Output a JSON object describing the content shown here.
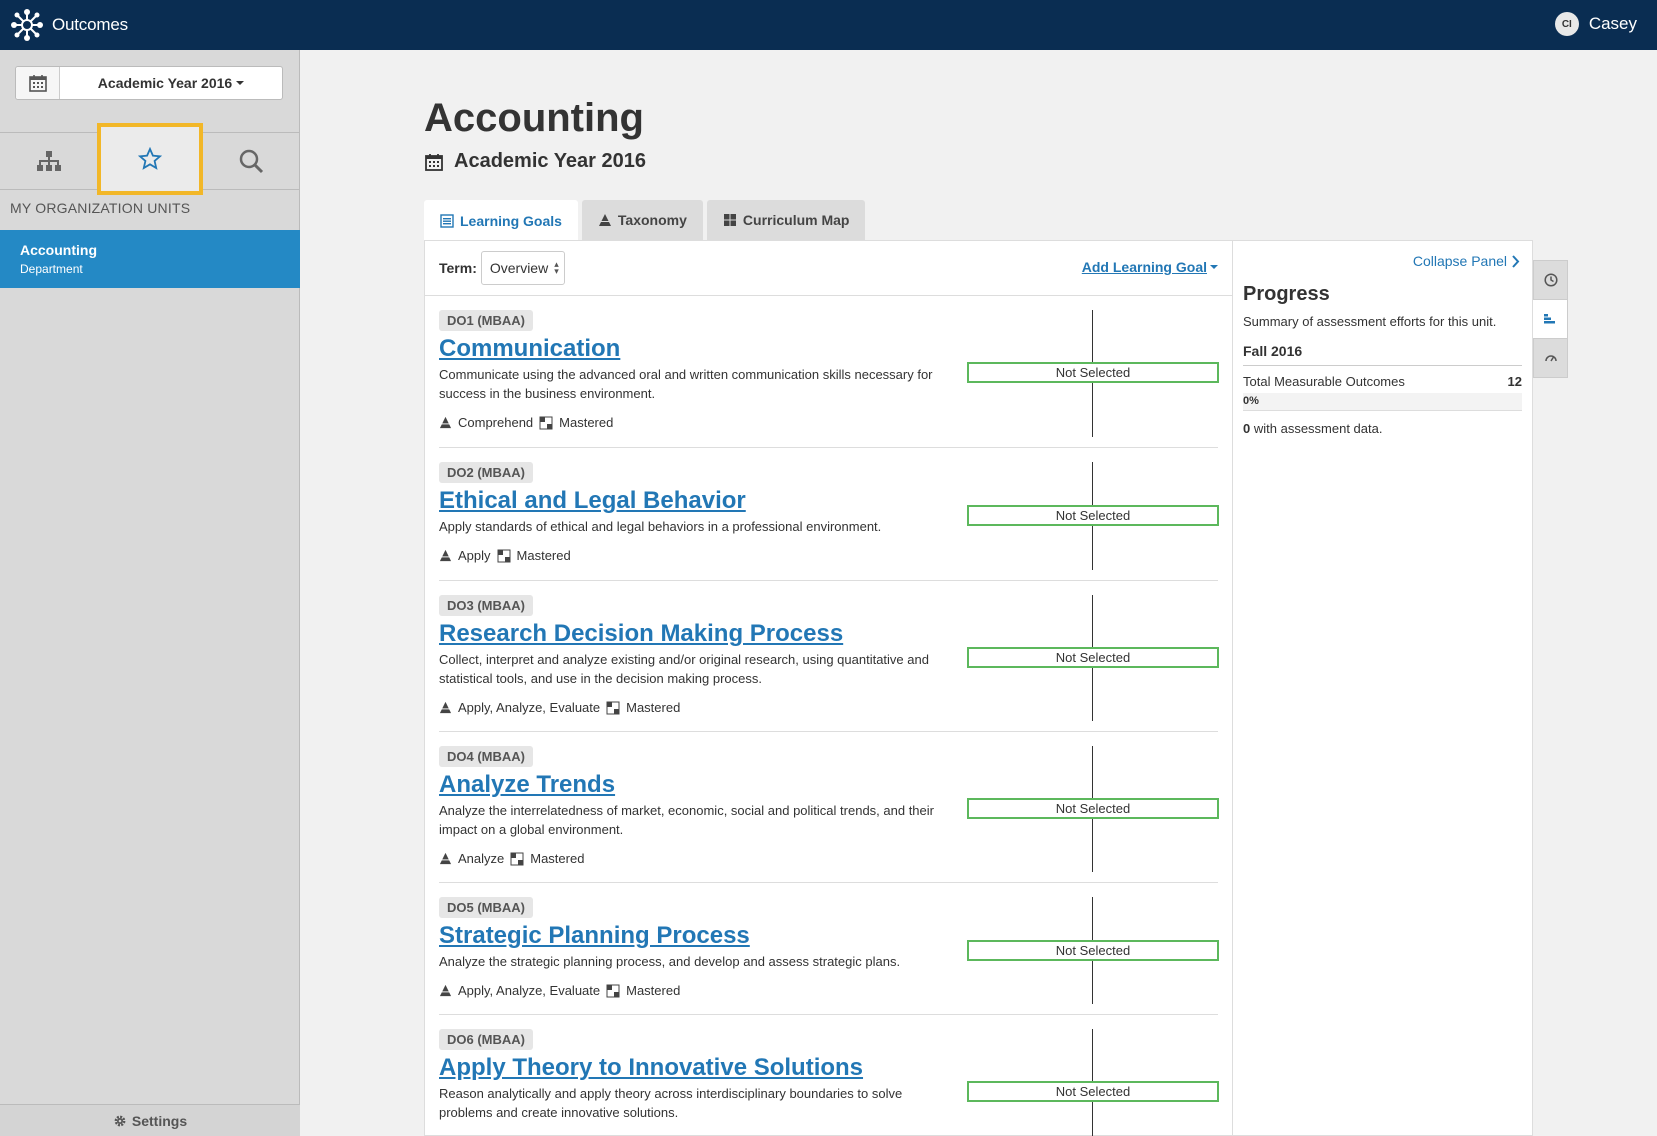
{
  "app": {
    "name": "Outcomes",
    "user_initials": "CI",
    "user_name": "Casey"
  },
  "sidebar": {
    "year_label": "Academic Year 2016",
    "section_label": "MY ORGANIZATION UNITS",
    "tabs": [
      {
        "icon": "hierarchy-icon",
        "active": false
      },
      {
        "icon": "star-icon",
        "active": true
      },
      {
        "icon": "search-icon",
        "active": false
      }
    ],
    "unit": {
      "name": "Accounting",
      "type": "Department"
    },
    "settings_label": "Settings"
  },
  "main": {
    "title": "Accounting",
    "subtitle": "Academic Year 2016",
    "tabs": [
      {
        "label": "Learning Goals",
        "icon": "list-icon",
        "active": true
      },
      {
        "label": "Taxonomy",
        "icon": "pyramid-icon",
        "active": false
      },
      {
        "label": "Curriculum Map",
        "icon": "grid-icon",
        "active": false
      }
    ],
    "term_label": "Term:",
    "term_value": "Overview",
    "add_goal_label": "Add Learning Goal",
    "goals": [
      {
        "code": "DO1 (MBAA)",
        "title": "Communication",
        "description": "Communicate using the advanced oral and written communication skills necessary for success in the business environment.",
        "taxonomy": "Comprehend",
        "level": "Mastered",
        "status": "Not Selected"
      },
      {
        "code": "DO2 (MBAA)",
        "title": "Ethical and Legal Behavior",
        "description": "Apply standards of ethical and legal behaviors in a professional environment.",
        "taxonomy": "Apply",
        "level": "Mastered",
        "status": "Not Selected"
      },
      {
        "code": "DO3 (MBAA)",
        "title": "Research Decision Making Process",
        "description": "Collect, interpret and analyze existing and/or original research, using quantitative and statistical tools, and use in the decision making process.",
        "taxonomy": "Apply, Analyze, Evaluate",
        "level": "Mastered",
        "status": "Not Selected"
      },
      {
        "code": "DO4 (MBAA)",
        "title": "Analyze Trends",
        "description": "Analyze the interrelatedness of market, economic, social and political trends, and their impact on a global environment.",
        "taxonomy": "Analyze",
        "level": "Mastered",
        "status": "Not Selected"
      },
      {
        "code": "DO5 (MBAA)",
        "title": "Strategic Planning Process",
        "description": "Analyze the strategic planning process, and develop and assess strategic plans.",
        "taxonomy": "Apply, Analyze, Evaluate",
        "level": "Mastered",
        "status": "Not Selected"
      },
      {
        "code": "DO6 (MBAA)",
        "title": "Apply Theory to Innovative Solutions",
        "description": "Reason analytically and apply theory across interdisciplinary boundaries to solve problems and create innovative solutions.",
        "taxonomy": "",
        "level": "",
        "status": "Not Selected"
      }
    ]
  },
  "right_panel": {
    "collapse_label": "Collapse Panel",
    "title": "Progress",
    "summary": "Summary of assessment efforts for this unit.",
    "term": "Fall 2016",
    "total_label": "Total Measurable Outcomes",
    "total_value": "12",
    "percent": "0%",
    "assessed_count": "0",
    "assessed_label": "with assessment data."
  },
  "colors": {
    "topbar": "#0a2d52",
    "accent": "#2277b5",
    "unit_highlight": "#2489c5",
    "tab_highlight": "#f2b728",
    "status_border": "#5cb85c"
  }
}
